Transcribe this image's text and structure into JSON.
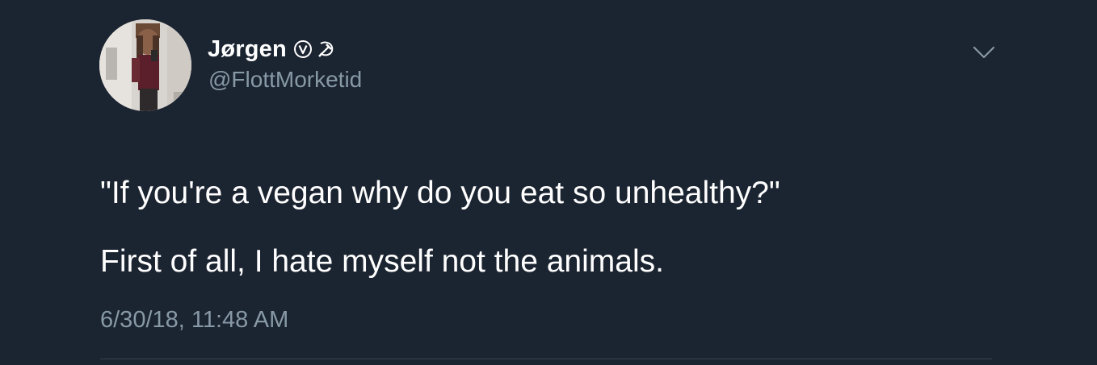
{
  "tweet": {
    "display_name": "Jørgen",
    "name_emojis": [
      "vegan-circle-v-icon",
      "hammer-and-sickle-icon"
    ],
    "handle": "@FlottMorketid",
    "text_lines": [
      "\"If you're a vegan why do you eat so unhealthy?\"",
      "First of all, I hate myself not the animals."
    ],
    "timestamp": "6/30/18, 11:48 AM",
    "menu_icon": "chevron-down-icon"
  },
  "colors": {
    "background": "#1b2431",
    "primary_text": "#ffffff",
    "secondary_text": "#8899a6",
    "divider": "#38444d"
  }
}
